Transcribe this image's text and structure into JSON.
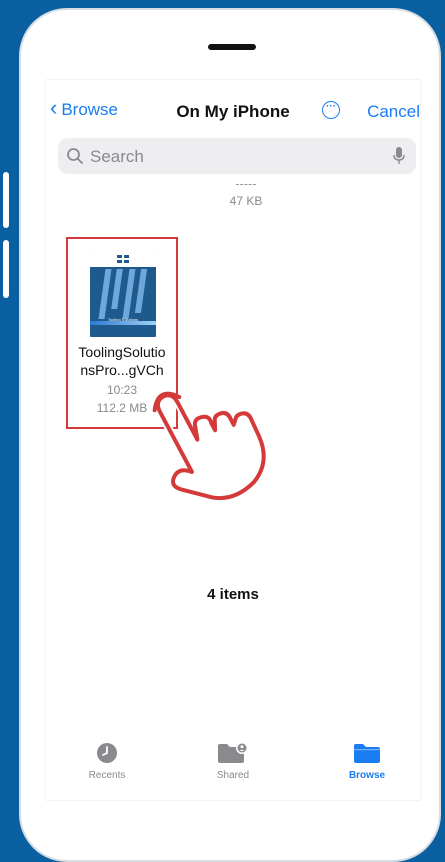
{
  "nav": {
    "back_label": "Browse",
    "title": "On My iPhone",
    "more_icon": "ellipsis-circle-icon",
    "cancel_label": "Cancel"
  },
  "search": {
    "placeholder": "Search",
    "icon": "search-icon",
    "mic_icon": "microphone-icon"
  },
  "partial_row": {
    "size": "47 KB"
  },
  "file": {
    "name_line1": "ToolingSolutio",
    "name_line2": "nsPro...gVCh",
    "time": "10:23",
    "size": "112.2 MB",
    "thumbnail_title": "Tooling Solutions"
  },
  "item_count": "4 items",
  "tabs": [
    {
      "label": "Recents",
      "icon": "clock-icon",
      "active": false
    },
    {
      "label": "Shared",
      "icon": "shared-folder-icon",
      "active": false
    },
    {
      "label": "Browse",
      "icon": "folder-icon",
      "active": true
    }
  ],
  "colors": {
    "background": "#0a5fa0",
    "accent": "#1a7cf3",
    "highlight": "#d43a3a"
  }
}
